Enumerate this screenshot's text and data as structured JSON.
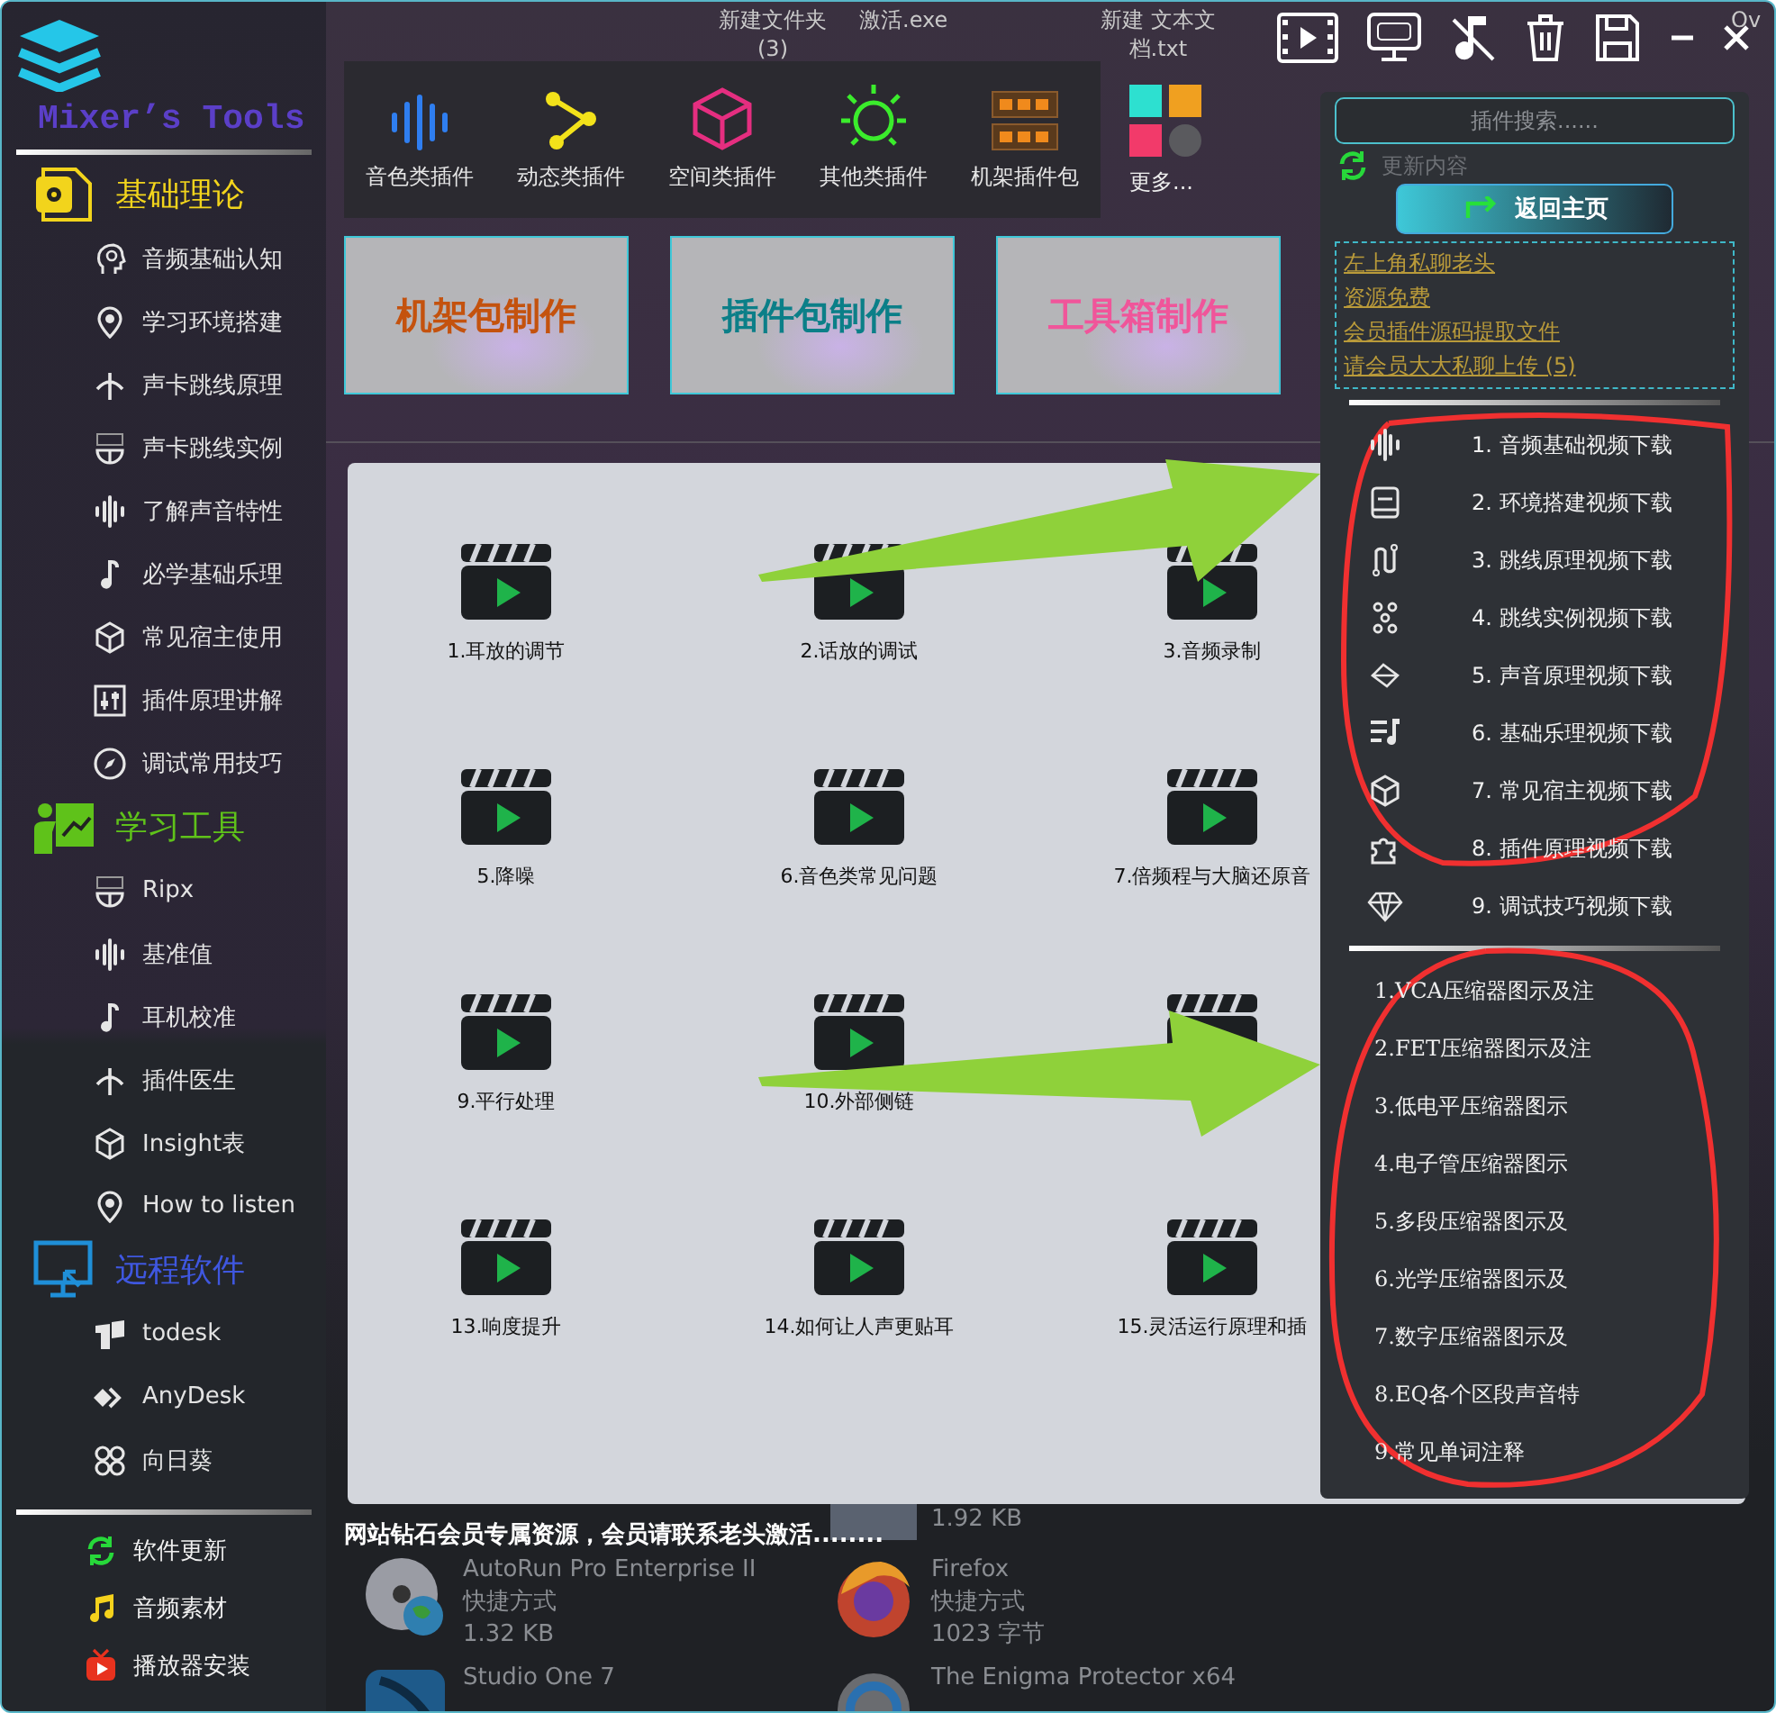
{
  "desktop_labels": [
    {
      "lines": [
        "新建文件夹",
        "(3)"
      ]
    },
    {
      "lines": [
        "激活.exe"
      ]
    },
    {
      "lines": [
        "新建 文本文",
        "档.txt"
      ]
    },
    {
      "lines": [
        "Ov"
      ]
    }
  ],
  "sidebar": {
    "title": "Mixer’s Tools",
    "sections": [
      {
        "title": "基础理论",
        "color": "#f2d41c",
        "items": [
          {
            "label": "音频基础认知"
          },
          {
            "label": "学习环境搭建"
          },
          {
            "label": "声卡跳线原理"
          },
          {
            "label": "声卡跳线实例"
          },
          {
            "label": "了解声音特性"
          },
          {
            "label": "必学基础乐理"
          },
          {
            "label": "常见宿主使用"
          },
          {
            "label": "插件原理讲解"
          },
          {
            "label": "调试常用技巧"
          }
        ]
      },
      {
        "title": "学习工具",
        "color": "#5fc21a",
        "items": [
          {
            "label": "Ripx"
          },
          {
            "label": "基准值"
          },
          {
            "label": "耳机校准"
          },
          {
            "label": "插件医生"
          },
          {
            "label": "Insight表"
          },
          {
            "label": "How to listen"
          }
        ]
      },
      {
        "title": "远程软件",
        "color": "#3f57e0",
        "items": [
          {
            "label": "todesk"
          },
          {
            "label": "AnyDesk"
          },
          {
            "label": "向日葵"
          }
        ]
      }
    ],
    "footer_items": [
      {
        "label": "软件更新"
      },
      {
        "label": "音频素材"
      },
      {
        "label": "播放器安装"
      }
    ]
  },
  "toolbar": {
    "categories": [
      {
        "label": "音色类插件"
      },
      {
        "label": "动态类插件"
      },
      {
        "label": "空间类插件"
      },
      {
        "label": "其他类插件"
      },
      {
        "label": "机架插件包"
      }
    ],
    "more_label": "更多..."
  },
  "banners": [
    {
      "label": "机架包制作",
      "color": "#c4520e"
    },
    {
      "label": "插件包制作",
      "color": "#0b7f88"
    },
    {
      "label": "工具箱制作",
      "color": "#f0559a"
    }
  ],
  "lesson_rows": [
    [
      {
        "label": "1.耳放的调节"
      },
      {
        "label": "2.话放的调试"
      },
      {
        "label": "3.音频录制"
      }
    ],
    [
      {
        "label": "5.降噪"
      },
      {
        "label": "6.音色类常见问题"
      },
      {
        "label": "7.倍频程与大脑还原音"
      }
    ],
    [
      {
        "label": "9.平行处理"
      },
      {
        "label": "10.外部侧链"
      }
    ],
    [
      {
        "label": "13.响度提升"
      },
      {
        "label": "14.如何让人声更贴耳"
      },
      {
        "label": "15.灵活运行原理和插"
      }
    ]
  ],
  "notice": "网站钻石会员专属资源，会员请联系老头激活........",
  "desktop_items": [
    {
      "lines": [
        "1.92 KB"
      ]
    },
    {
      "lines": [
        "AutoRun Pro Enterprise II",
        "快捷方式",
        "1.32 KB"
      ]
    },
    {
      "lines": [
        "Firefox",
        "快捷方式",
        "1023 字节"
      ]
    },
    {
      "lines": [
        "Studio One 7"
      ]
    },
    {
      "lines": [
        "The Enigma Protector x64"
      ]
    }
  ],
  "plugin_panel": {
    "search": {
      "placeholder": "插件搜索......"
    },
    "update_label": "更新内容",
    "home_button": "返回主页",
    "links": [
      "左上角私聊老头",
      "资源免费",
      "会员插件源码提取文件",
      "请会员大大私聊上传 (5)"
    ],
    "video_downloads": [
      "1. 音频基础视频下载",
      "2. 环境搭建视频下载",
      "3. 跳线原理视频下载",
      "4. 跳线实例视频下载",
      "5. 声音原理视频下载",
      "6. 基础乐理视频下载",
      "7. 常见宿主视频下载",
      "8. 插件原理视频下载",
      "9. 调试技巧视频下载"
    ],
    "diagrams": [
      "1.VCA压缩器图示及注",
      "2.FET压缩器图示及注",
      "3.低电平压缩器图示",
      "4.电子管压缩器图示",
      "5.多段压缩器图示及",
      "6.光学压缩器图示及",
      "7.数字压缩器图示及",
      "8.EQ各个区段声音特",
      "9.常见单词注释"
    ]
  }
}
